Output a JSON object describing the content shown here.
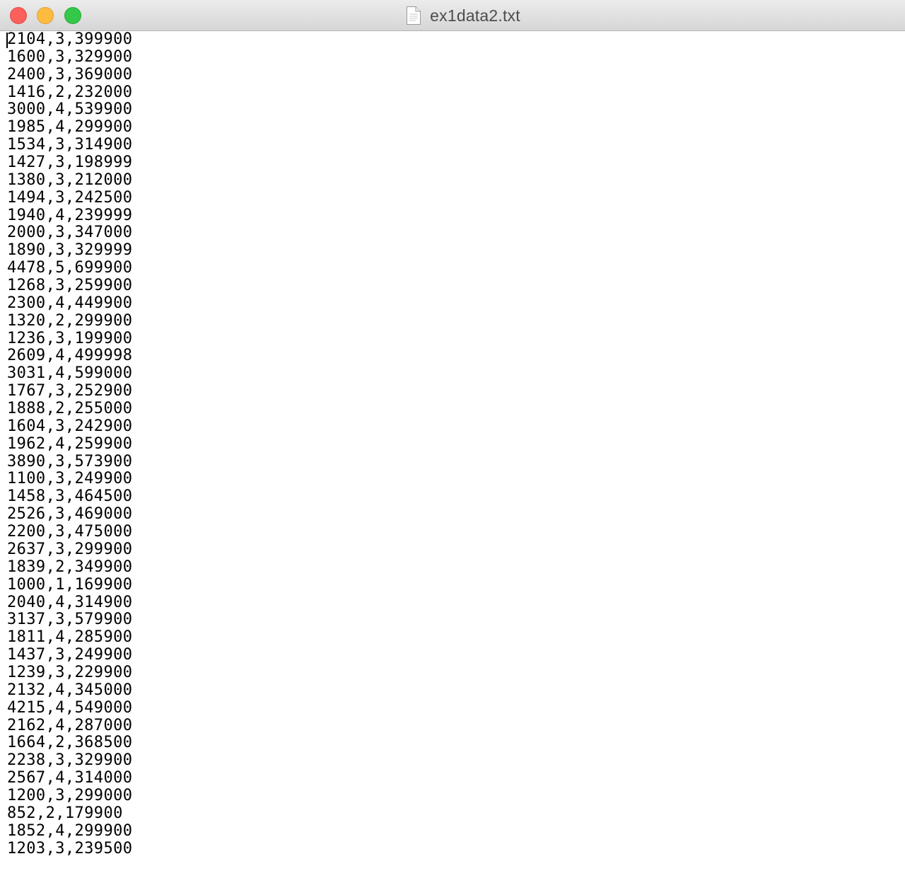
{
  "window": {
    "title": "ex1data2.txt",
    "icons": {
      "close": "close-icon",
      "minimize": "minimize-icon",
      "zoom": "zoom-icon",
      "document": "document-icon"
    },
    "colors": {
      "close": "#fc605b",
      "minimize": "#fdbc40",
      "zoom": "#34c84a"
    }
  },
  "editor": {
    "lines": [
      "2104,3,399900",
      "1600,3,329900",
      "2400,3,369000",
      "1416,2,232000",
      "3000,4,539900",
      "1985,4,299900",
      "1534,3,314900",
      "1427,3,198999",
      "1380,3,212000",
      "1494,3,242500",
      "1940,4,239999",
      "2000,3,347000",
      "1890,3,329999",
      "4478,5,699900",
      "1268,3,259900",
      "2300,4,449900",
      "1320,2,299900",
      "1236,3,199900",
      "2609,4,499998",
      "3031,4,599000",
      "1767,3,252900",
      "1888,2,255000",
      "1604,3,242900",
      "1962,4,259900",
      "3890,3,573900",
      "1100,3,249900",
      "1458,3,464500",
      "2526,3,469000",
      "2200,3,475000",
      "2637,3,299900",
      "1839,2,349900",
      "1000,1,169900",
      "2040,4,314900",
      "3137,3,579900",
      "1811,4,285900",
      "1437,3,249900",
      "1239,3,229900",
      "2132,4,345000",
      "4215,4,549000",
      "2162,4,287000",
      "1664,2,368500",
      "2238,3,329900",
      "2567,4,314000",
      "1200,3,299000",
      "852,2,179900",
      "1852,4,299900",
      "1203,3,239500"
    ]
  }
}
